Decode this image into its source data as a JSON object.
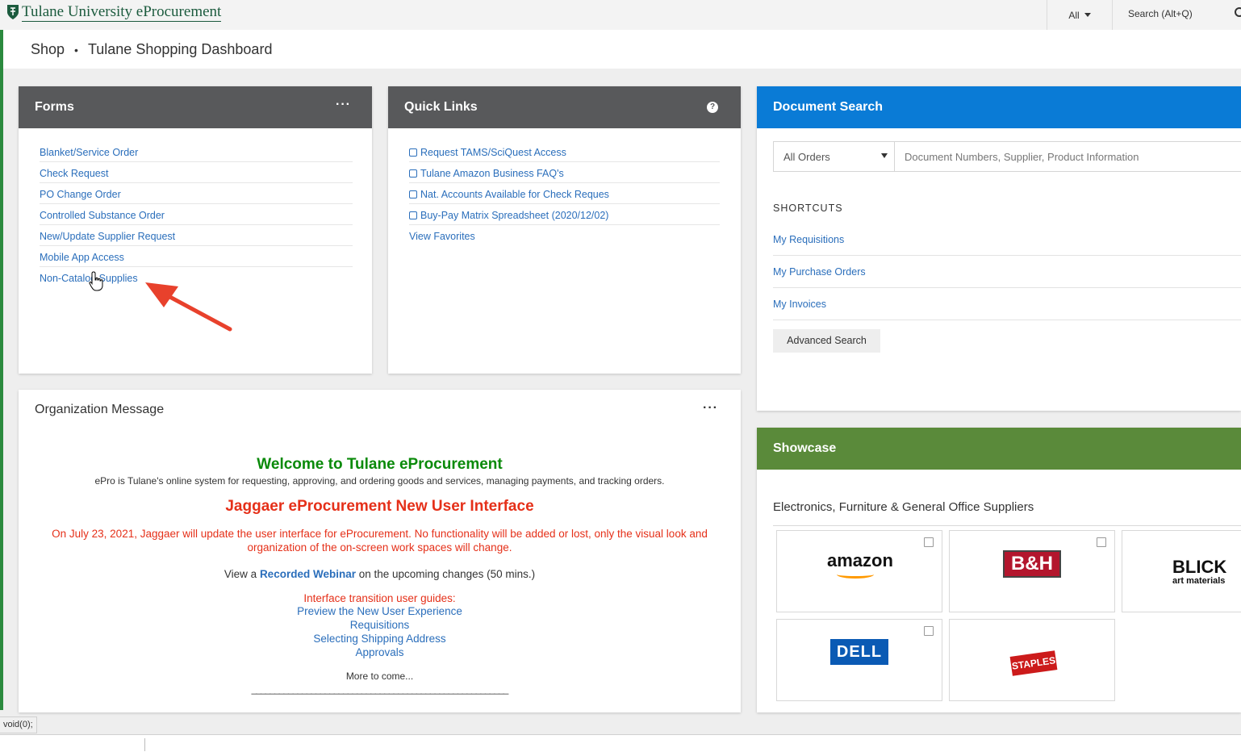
{
  "header": {
    "logo_primary": "Tulane University",
    "logo_secondary": "eProcurement",
    "scope_label": "All",
    "search_placeholder": "Search (Alt+Q)"
  },
  "breadcrumb": {
    "items": [
      "Shop",
      "Tulane Shopping Dashboard"
    ]
  },
  "forms": {
    "title": "Forms",
    "menu": "···",
    "links": [
      "Blanket/Service Order",
      "Check Request",
      "PO Change Order",
      "Controlled Substance Order",
      "New/Update Supplier Request",
      "Mobile App Access",
      "Non-Catalog Supplies"
    ]
  },
  "quick_links": {
    "title": "Quick Links",
    "help": "?",
    "links": [
      "Request TAMS/SciQuest Access",
      "Tulane Amazon Business FAQ's",
      "Nat. Accounts Available for Check Reques",
      "Buy-Pay Matrix Spreadsheet (2020/12/02)",
      "View Favorites"
    ]
  },
  "doc_search": {
    "title": "Document Search",
    "select_value": "All Orders",
    "input_placeholder": "Document Numbers, Supplier, Product Information",
    "shortcuts_heading": "SHORTCUTS",
    "shortcuts": [
      "My Requisitions",
      "My Purchase Orders",
      "My Invoices"
    ],
    "advanced_button": "Advanced Search"
  },
  "org_message": {
    "title": "Organization Message",
    "menu": "···",
    "welcome": "Welcome to Tulane eProcurement",
    "welcome_sub": "ePro is Tulane's online system for requesting, approving, and ordering goods and services, managing payments, and tracking orders.",
    "jag_title": "Jaggaer eProcurement New User Interface",
    "jag_text": "On July 23, 2021, Jaggaer will update the user interface for eProcurement. No functionality will be added or lost, only the visual look and organization of the on-screen work spaces will change.",
    "webinar_prefix": "View a",
    "webinar_link": "Recorded Webinar",
    "webinar_suffix": "on the upcoming changes (50 mins.)",
    "guides_heading": "Interface transition user guides:",
    "guides": [
      "Preview the New User Experience",
      "Requisitions",
      "Selecting Shipping Address",
      "Approvals"
    ],
    "more": "More to come...",
    "rule": "________________________________________________________"
  },
  "showcase": {
    "title": "Showcase",
    "subtitle": "Electronics, Furniture & General Office Suppliers",
    "suppliers": {
      "amazon": "amazon",
      "bh": "B&H",
      "blick": "BLICK",
      "blick_sub": "art materials",
      "dell": "DELL",
      "staples": "STAPLES"
    }
  },
  "status_bar": {
    "text": "void(0);"
  },
  "colors": {
    "panel_header_dark": "#58595b",
    "doc_search_header": "#0a7bd6",
    "showcase_header": "#5a8a3a",
    "link": "#2a6ebb",
    "welcome_green": "#0a8a0a",
    "alert_red": "#e53019",
    "arrow_red": "#e8412c"
  }
}
